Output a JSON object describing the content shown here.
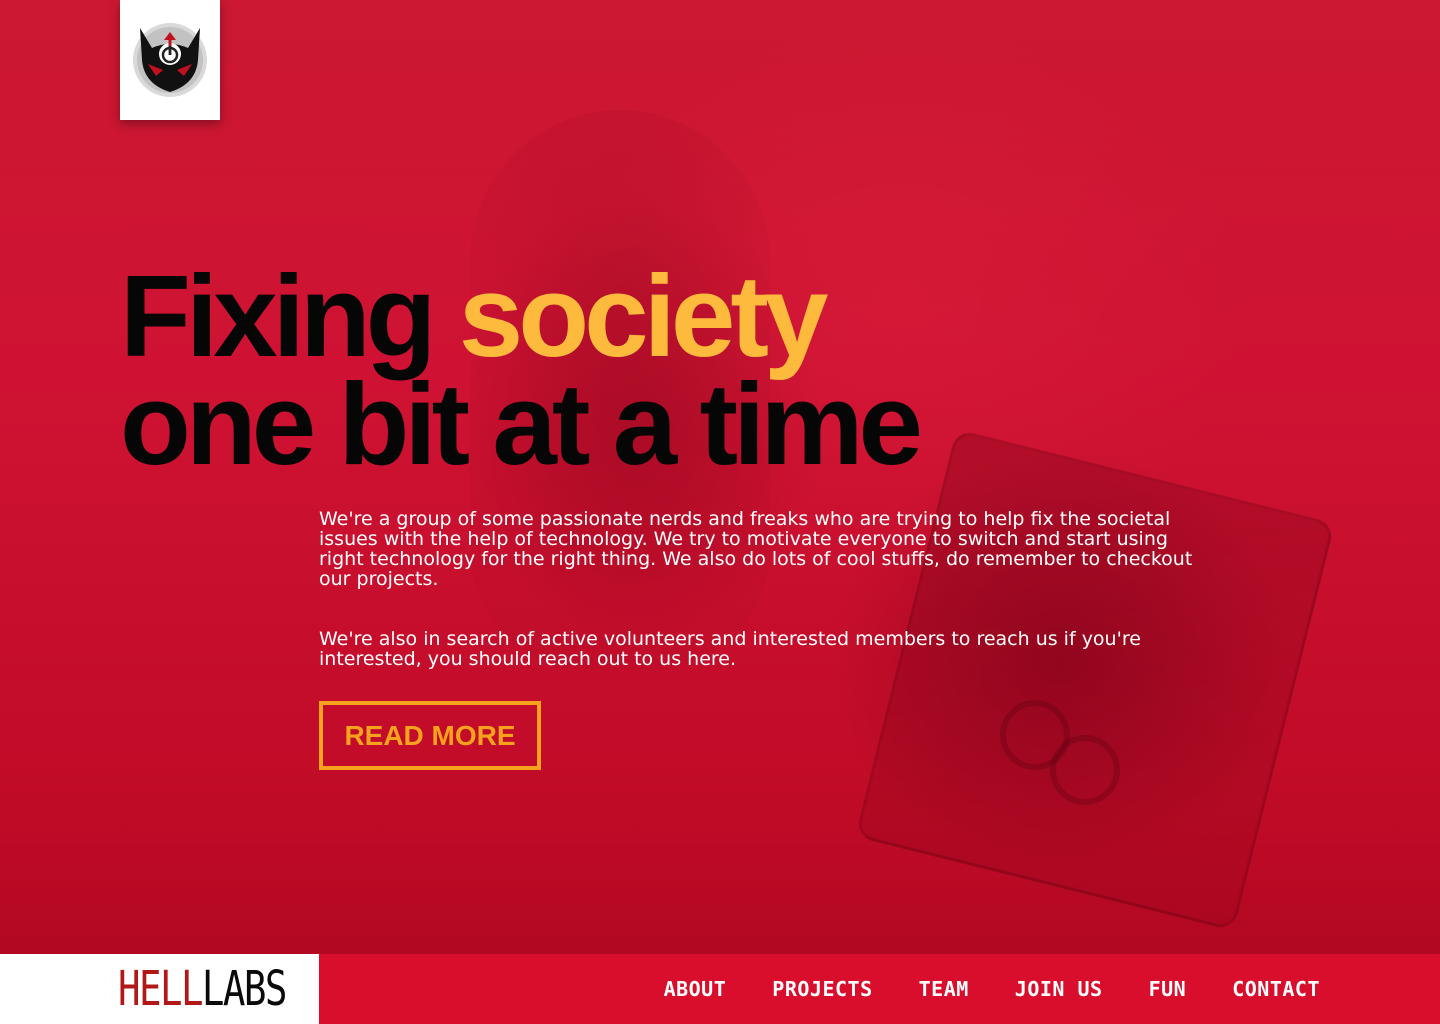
{
  "colors": {
    "hero_red": "#cc1832",
    "headline_black": "#060606",
    "accent_yellow": "#fdba3c",
    "button_orange": "#f7a21d",
    "footer_red": "#d80e2c",
    "brand_red": "#b21818"
  },
  "logo": {
    "icon": "devil-power-icon"
  },
  "hero": {
    "headline_part1": "Fixing ",
    "headline_accent": "society",
    "headline_line2": "one bit at a time",
    "paragraph1": "We're a group of some passionate nerds and freaks who are trying to help fix the societal issues with the help of technology. We try to motivate everyone to switch and start using right technology for the right thing. We also do lots of cool stuffs, do remember to checkout our projects.",
    "paragraph2": "We're also in search of active volunteers and interested members to reach us if you're interested, you should reach out to us here.",
    "read_more_label": "READ MORE"
  },
  "footer": {
    "brand_hell": "HELL",
    "brand_labs": "LABS",
    "nav": [
      {
        "label": "ABOUT"
      },
      {
        "label": "PROJECTS"
      },
      {
        "label": "TEAM"
      },
      {
        "label": "JOIN US"
      },
      {
        "label": "FUN"
      },
      {
        "label": "CONTACT"
      }
    ]
  }
}
